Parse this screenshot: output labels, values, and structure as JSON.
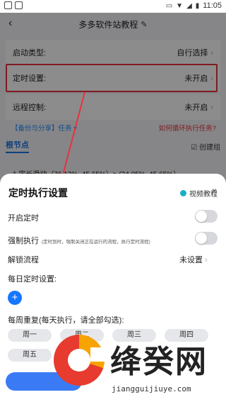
{
  "status_bar": {
    "time": "11:05",
    "icons": [
      "notification-square-icon",
      "notification-square-icon",
      "cast-icon",
      "wifi-icon",
      "signal-icon",
      "battery-icon"
    ]
  },
  "header": {
    "title": "多多软件站教程"
  },
  "settings_rows": [
    {
      "label": "启动类型:",
      "value": "自行选择"
    },
    {
      "label": "定时设置:",
      "value": "未开启"
    },
    {
      "label": "远程控制:",
      "value": "未开启"
    }
  ],
  "links": {
    "backup_share": "【备份与分享】任务 ▾",
    "loop_help": "如何循环执行任务?"
  },
  "tabs": {
    "root_node": "根节点",
    "create_group": "创建组"
  },
  "background_item": "1.定长滑动（76.13%, 45.65%）> (24.05%, 45.65%）",
  "sheet": {
    "title": "定时执行设置",
    "video_tutorial": "视频教程",
    "close": "×",
    "enable_timer": "开启定时",
    "force_run": "强制执行",
    "force_run_desc": "(定时到时，强制关闭正在运行的流程，执行定时流程)",
    "unlock_flow": "解锁流程",
    "unlock_value": "未设置",
    "daily_label": "每日定时设置:",
    "plus": "+",
    "weekly_label": "每周重复(每天执行，请全部勾选):",
    "days": [
      "周一",
      "周二",
      "周三",
      "周四",
      "周五"
    ]
  },
  "watermark": {
    "brand": "绛癸网",
    "domain": "jiangguijiuye.com"
  },
  "colors": {
    "accent_blue": "#1677ff",
    "highlight_red": "#e8323c",
    "link_red": "#e8323c"
  }
}
